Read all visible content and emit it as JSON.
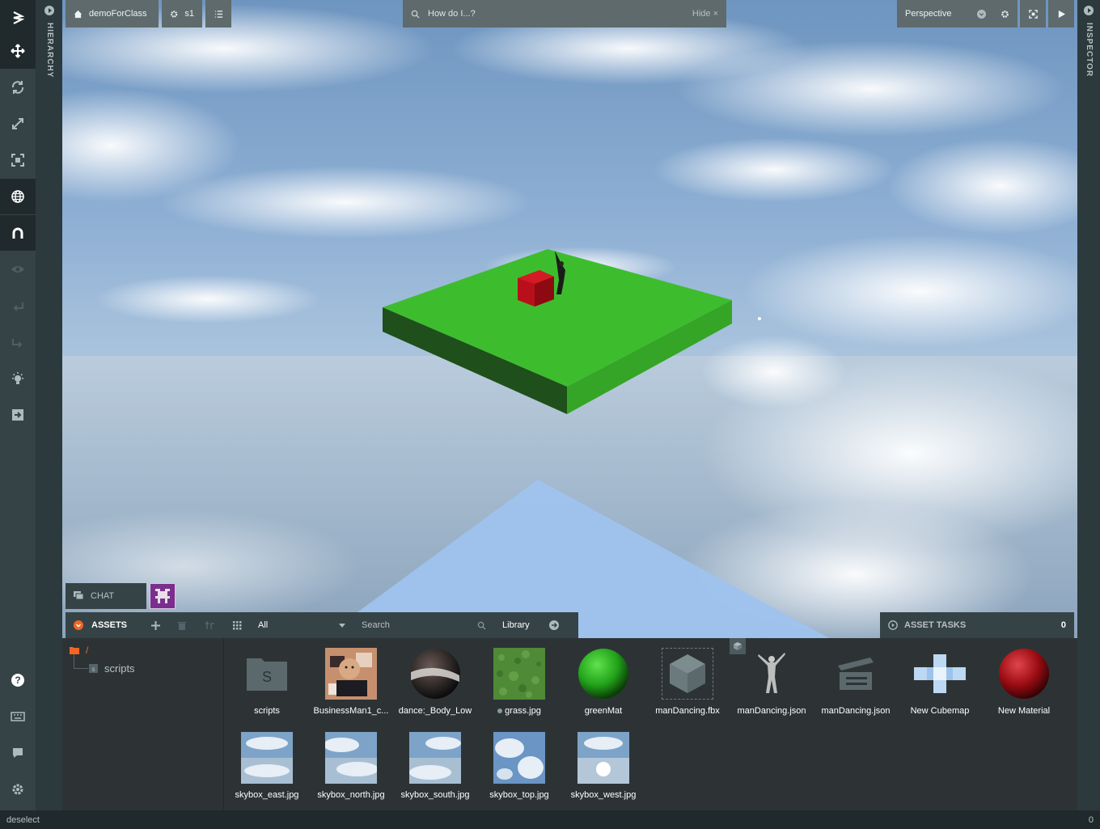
{
  "toolbar": {
    "tools": [
      "translate-icon",
      "rotate-icon",
      "scale-icon",
      "resize-icon",
      "world-icon",
      "magnet-icon",
      "eye-icon",
      "undo-icon",
      "redo-icon",
      "lightbulb-icon",
      "publish-icon"
    ],
    "bottom": [
      "help-icon",
      "keyboard-icon",
      "chat-icon",
      "settings-icon"
    ]
  },
  "hierarchy": {
    "label": "HIERARCHY"
  },
  "inspector": {
    "label": "INSPECTOR"
  },
  "viewport": {
    "project_label": "demoForClass",
    "scene_label": "s1",
    "search_placeholder": "How do I...?",
    "hide_label": "Hide",
    "camera_label": "Perspective"
  },
  "chat": {
    "label": "CHAT"
  },
  "assets": {
    "title": "ASSETS",
    "filter_value": "All",
    "search_placeholder": "Search",
    "library_label": "Library",
    "tree_root": "/",
    "tree_child": "scripts",
    "items": [
      {
        "name": "scripts",
        "kind": "folder"
      },
      {
        "name": "BusinessMan1_c...",
        "kind": "texture-face"
      },
      {
        "name": "dance:_Body_Low",
        "kind": "material-dark"
      },
      {
        "name": "grass.jpg",
        "kind": "texture-grass"
      },
      {
        "name": "greenMat",
        "kind": "material-green"
      },
      {
        "name": "manDancing.fbx",
        "kind": "model"
      },
      {
        "name": "manDancing.json",
        "kind": "figure"
      },
      {
        "name": "manDancing.json",
        "kind": "animation"
      },
      {
        "name": "New Cubemap",
        "kind": "cubemap"
      },
      {
        "name": "New Material",
        "kind": "material-red"
      },
      {
        "name": "skybox_east.jpg",
        "kind": "sky"
      },
      {
        "name": "skybox_north.jpg",
        "kind": "sky"
      },
      {
        "name": "skybox_south.jpg",
        "kind": "sky"
      },
      {
        "name": "skybox_top.jpg",
        "kind": "sky-top"
      },
      {
        "name": "skybox_west.jpg",
        "kind": "sky-west"
      }
    ]
  },
  "asset_tasks": {
    "label": "ASSET TASKS",
    "count": "0"
  },
  "status": {
    "left": "deselect",
    "right": "0"
  },
  "colors": {
    "accent": "#f26522",
    "panel": "#364346",
    "ground": "#3dbd2e",
    "cube": "#c0101a"
  }
}
